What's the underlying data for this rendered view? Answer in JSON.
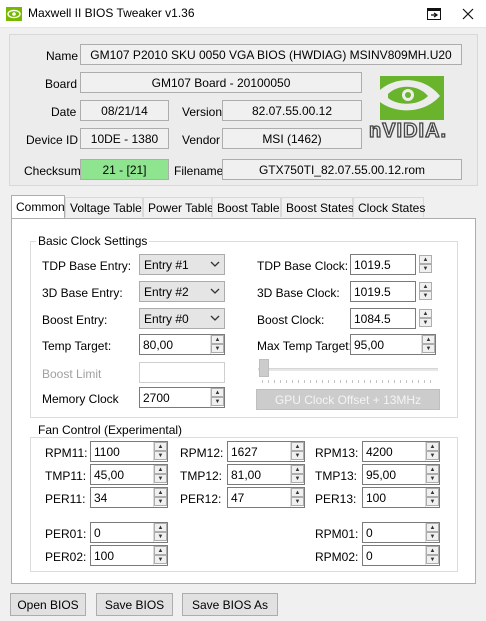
{
  "window": {
    "title": "Maxwell II BIOS Tweaker v1.36",
    "icon": "nvidia-eye-icon",
    "restore_icon": "restore-window-icon",
    "close_icon": "close-icon"
  },
  "info": {
    "name_label": "Name",
    "name_value": "GM107 P2010 SKU 0050 VGA BIOS (HWDIAG) MSINV809MH.U20",
    "board_label": "Board",
    "board_value": "GM107 Board - 20100050",
    "date_label": "Date",
    "date_value": "08/21/14",
    "version_label": "Version",
    "version_value": "82.07.55.00.12",
    "device_id_label": "Device ID",
    "device_id_value": "10DE - 1380",
    "vendor_label": "Vendor",
    "vendor_value": "MSI (1462)",
    "checksum_label": "Checksum",
    "checksum_value": "21 - [21]",
    "checksum_color": "#8fe58f",
    "filename_label": "Filename",
    "filename_value": "GTX750TI_82.07.55.00.12.rom",
    "logo_text": "nVIDIA.",
    "logo_color": "#6ab42d"
  },
  "tabs": [
    "Common",
    "Voltage Table",
    "Power Table",
    "Boost Table",
    "Boost States",
    "Clock States"
  ],
  "active_tab": "Common",
  "basic_clock": {
    "title": "Basic Clock Settings",
    "tdp_base_entry_label": "TDP Base Entry:",
    "tdp_base_entry_value": "Entry #1",
    "base_3d_entry_label": "3D Base Entry:",
    "base_3d_entry_value": "Entry #2",
    "boost_entry_label": "Boost Entry:",
    "boost_entry_value": "Entry #0",
    "temp_target_label": "Temp Target:",
    "temp_target_value": "80,00",
    "boost_limit_label": "Boost Limit",
    "boost_limit_value": "",
    "memory_clock_label": "Memory Clock",
    "memory_clock_value": "2700",
    "tdp_base_clock_label": "TDP Base Clock:",
    "tdp_base_clock_value": "1019.5",
    "base_3d_clock_label": "3D Base Clock:",
    "base_3d_clock_value": "1019.5",
    "boost_clock_label": "Boost Clock:",
    "boost_clock_value": "1084.5",
    "max_temp_target_label": "Max Temp Target:",
    "max_temp_target_value": "95,00",
    "gpu_offset_button": "GPU Clock Offset + 13MHz",
    "offset_slider_level": 0
  },
  "fan_control": {
    "title": "Fan Control (Experimental)",
    "rpm11_label": "RPM11:",
    "rpm11_value": "1100",
    "tmp11_label": "TMP11:",
    "tmp11_value": "45,00",
    "per11_label": "PER11:",
    "per11_value": "34",
    "rpm12_label": "RPM12:",
    "rpm12_value": "1627",
    "tmp12_label": "TMP12:",
    "tmp12_value": "81,00",
    "per12_label": "PER12:",
    "per12_value": "47",
    "rpm13_label": "RPM13:",
    "rpm13_value": "4200",
    "tmp13_label": "TMP13:",
    "tmp13_value": "95,00",
    "per13_label": "PER13:",
    "per13_value": "100",
    "per01_label": "PER01:",
    "per01_value": "0",
    "per02_label": "PER02:",
    "per02_value": "100",
    "rpm01_label": "RPM01:",
    "rpm01_value": "0",
    "rpm02_label": "RPM02:",
    "rpm02_value": "0"
  },
  "buttons": {
    "open_bios": "Open BIOS",
    "save_bios": "Save BIOS",
    "save_bios_as": "Save BIOS As"
  }
}
